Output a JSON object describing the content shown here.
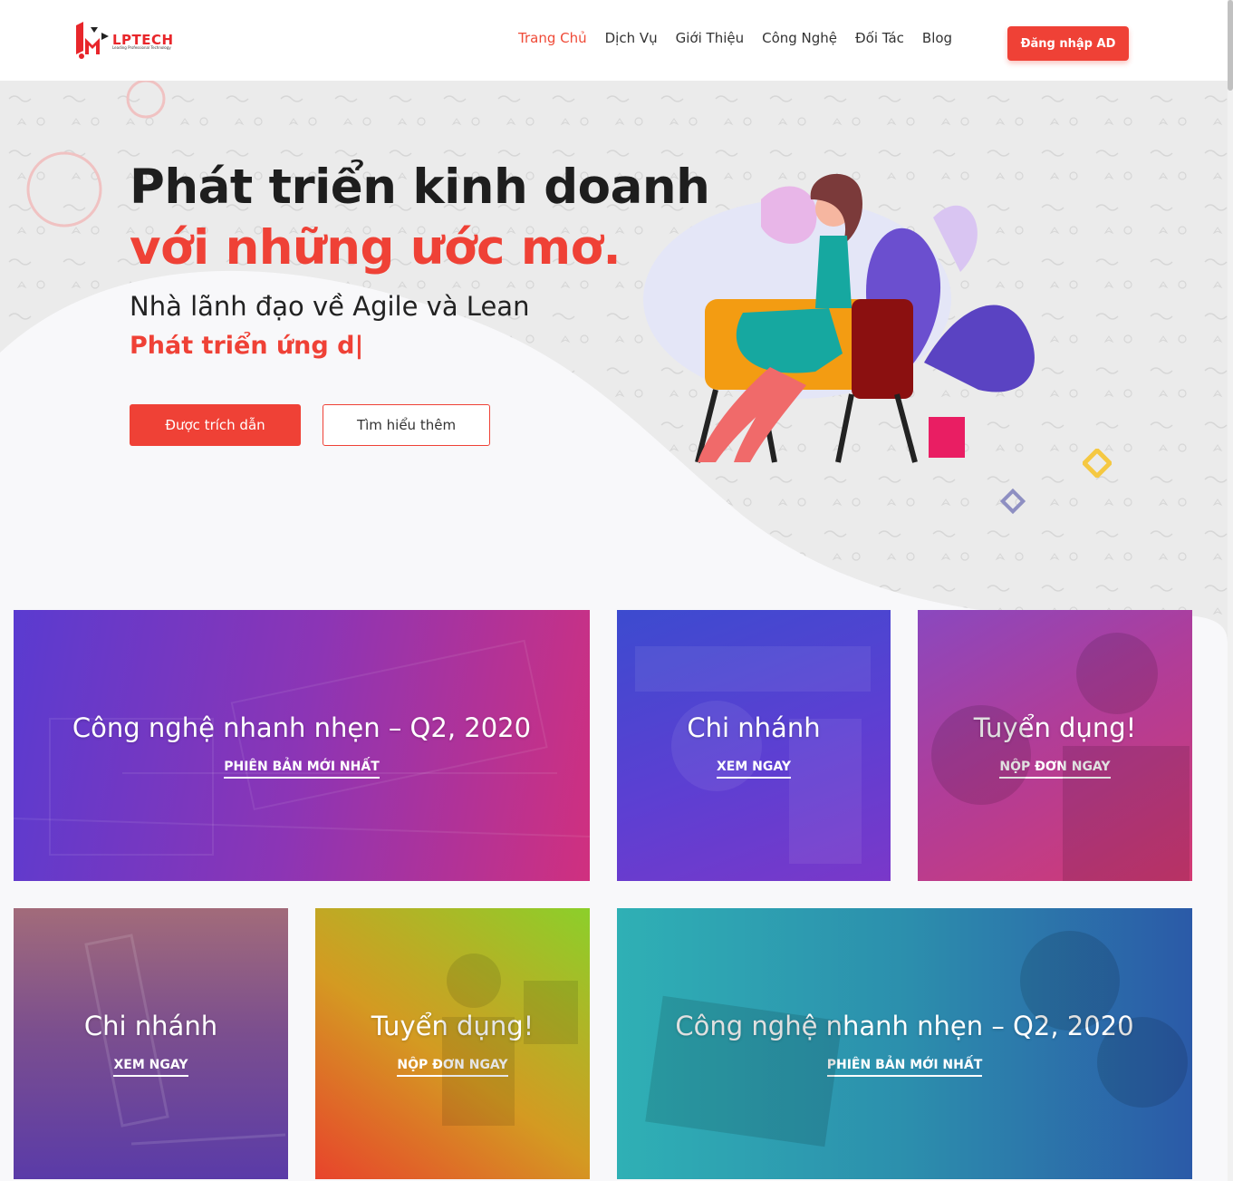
{
  "header": {
    "logo_text": "LPTECH",
    "logo_tagline": "Leading Professional Technology",
    "nav": [
      {
        "label": "Trang Chủ",
        "active": true
      },
      {
        "label": "Dịch Vụ",
        "active": false
      },
      {
        "label": "Giới Thiệu",
        "active": false
      },
      {
        "label": "Công Nghệ",
        "active": false
      },
      {
        "label": "Đối Tác",
        "active": false
      },
      {
        "label": "Blog",
        "active": false
      }
    ],
    "login_label": "Đăng nhập AD"
  },
  "hero": {
    "title_line1": "Phát triển kinh doanh",
    "title_line2": "với những ước mơ.",
    "subtitle": "Nhà lãnh đạo về Agile và Lean",
    "typed_text": "Phát triển ứng d|",
    "primary_button": "Được trích dẫn",
    "secondary_button": "Tìm hiểu thêm"
  },
  "cards": [
    {
      "title": "Công nghệ nhanh nhẹn – Q2, 2020",
      "link": "PHIÊN BẢN MỚI NHẤT"
    },
    {
      "title": "Chi nhánh",
      "link": "XEM NGAY"
    },
    {
      "title": "Tuyển dụng!",
      "link": "NỘP ĐƠN NGAY"
    },
    {
      "title": "Chi nhánh",
      "link": "XEM NGAY"
    },
    {
      "title": "Tuyển dụng!",
      "link": "NỘP ĐƠN NGAY"
    },
    {
      "title": "Công nghệ nhanh nhẹn – Q2, 2020",
      "link": "PHIÊN BẢN MỚI NHẤT"
    }
  ],
  "colors": {
    "brand": "#ef4136",
    "dark_text": "#1e1e1e",
    "background": "#ebebeb"
  }
}
